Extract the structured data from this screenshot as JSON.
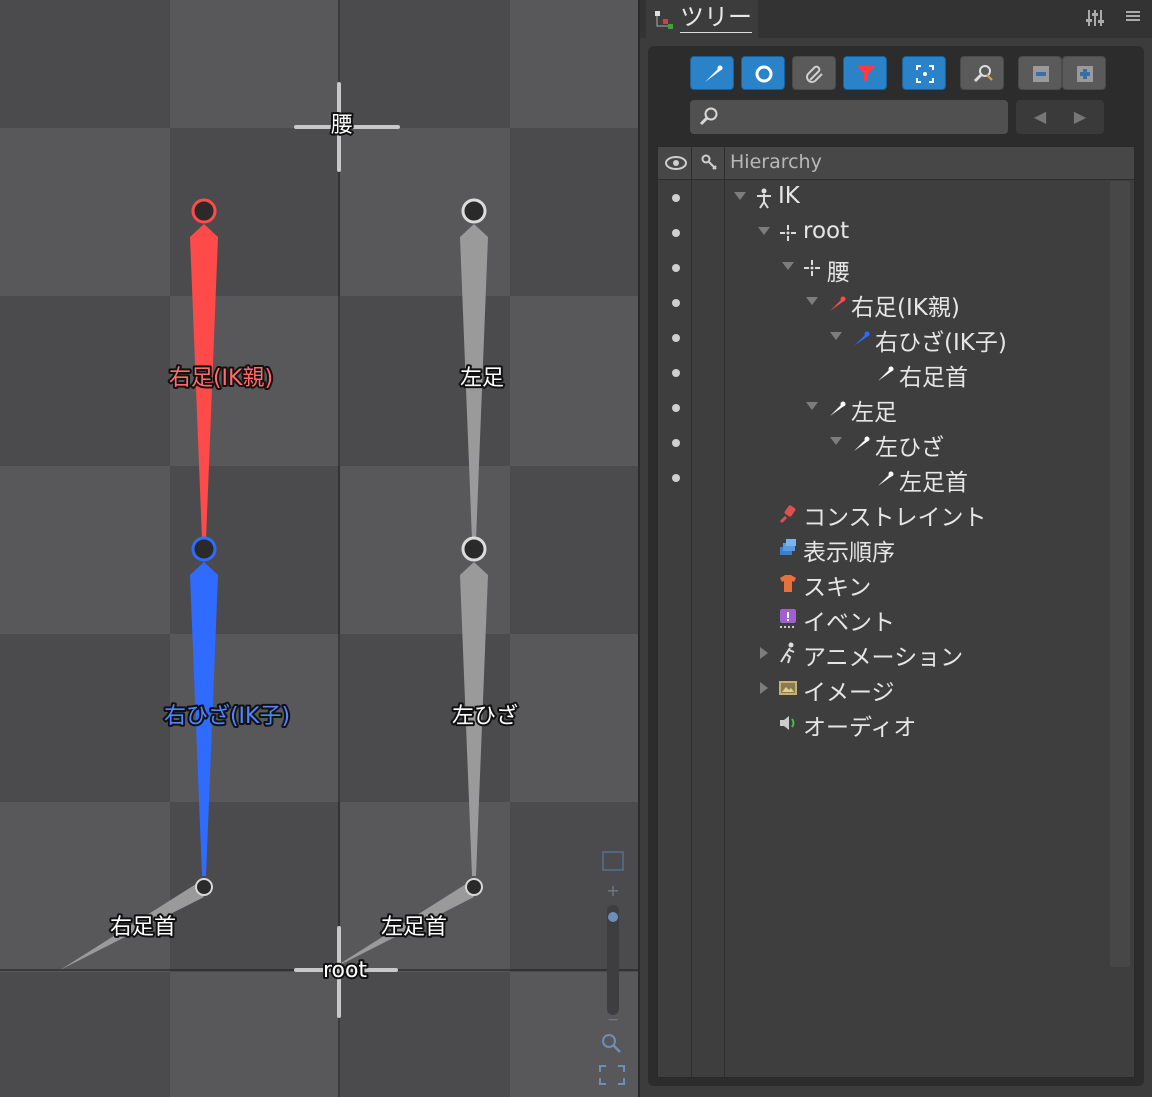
{
  "viewport": {
    "bones": [
      {
        "name": "腰",
        "color": "#ffffff"
      },
      {
        "name": "右足(IK親)",
        "color": "#ff4a4a"
      },
      {
        "name": "右ひざ(IK子)",
        "color": "#2f6bff"
      },
      {
        "name": "右足首",
        "color": "#ffffff"
      },
      {
        "name": "左足",
        "color": "#ffffff"
      },
      {
        "name": "左ひざ",
        "color": "#ffffff"
      },
      {
        "name": "左足首",
        "color": "#ffffff"
      },
      {
        "name": "root",
        "color": "#ffffff"
      }
    ]
  },
  "panel": {
    "tab_label": "ツリー",
    "search": {
      "value": "",
      "placeholder": ""
    },
    "tree_header": "Hierarchy",
    "toolbar_buttons": [
      {
        "icon": "bone-icon",
        "state": "on"
      },
      {
        "icon": "slot-icon",
        "state": "on"
      },
      {
        "icon": "attachment-icon",
        "state": "off"
      },
      {
        "icon": "filter-icon",
        "state": "on"
      },
      {
        "icon": "focus-icon",
        "state": "on"
      },
      {
        "icon": "find-icon",
        "state": "off"
      },
      {
        "icon": "collapse-icon",
        "state": "off"
      },
      {
        "icon": "expand-icon",
        "state": "off"
      }
    ],
    "tree": [
      {
        "label": "IK",
        "icon": "skeleton-icon"
      },
      {
        "label": "root",
        "icon": "bone-node-icon"
      },
      {
        "label": "腰",
        "icon": "bone-node-icon"
      },
      {
        "label": "右足(IK親)",
        "icon": "bone-icon",
        "icon_color": "#ff4a4a"
      },
      {
        "label": "右ひざ(IK子)",
        "icon": "bone-icon",
        "icon_color": "#2f6bff"
      },
      {
        "label": "右足首",
        "icon": "bone-icon",
        "icon_color": "#ffffff"
      },
      {
        "label": "左足",
        "icon": "bone-icon",
        "icon_color": "#ffffff"
      },
      {
        "label": "左ひざ",
        "icon": "bone-icon",
        "icon_color": "#ffffff"
      },
      {
        "label": "左足首",
        "icon": "bone-icon",
        "icon_color": "#ffffff"
      },
      {
        "label": "コンストレイント",
        "icon": "constraint-icon"
      },
      {
        "label": "表示順序",
        "icon": "draw-order-icon"
      },
      {
        "label": "スキン",
        "icon": "skin-icon"
      },
      {
        "label": "イベント",
        "icon": "event-icon"
      },
      {
        "label": "アニメーション",
        "icon": "animation-icon"
      },
      {
        "label": "イメージ",
        "icon": "images-icon"
      },
      {
        "label": "オーディオ",
        "icon": "audio-icon"
      }
    ]
  }
}
